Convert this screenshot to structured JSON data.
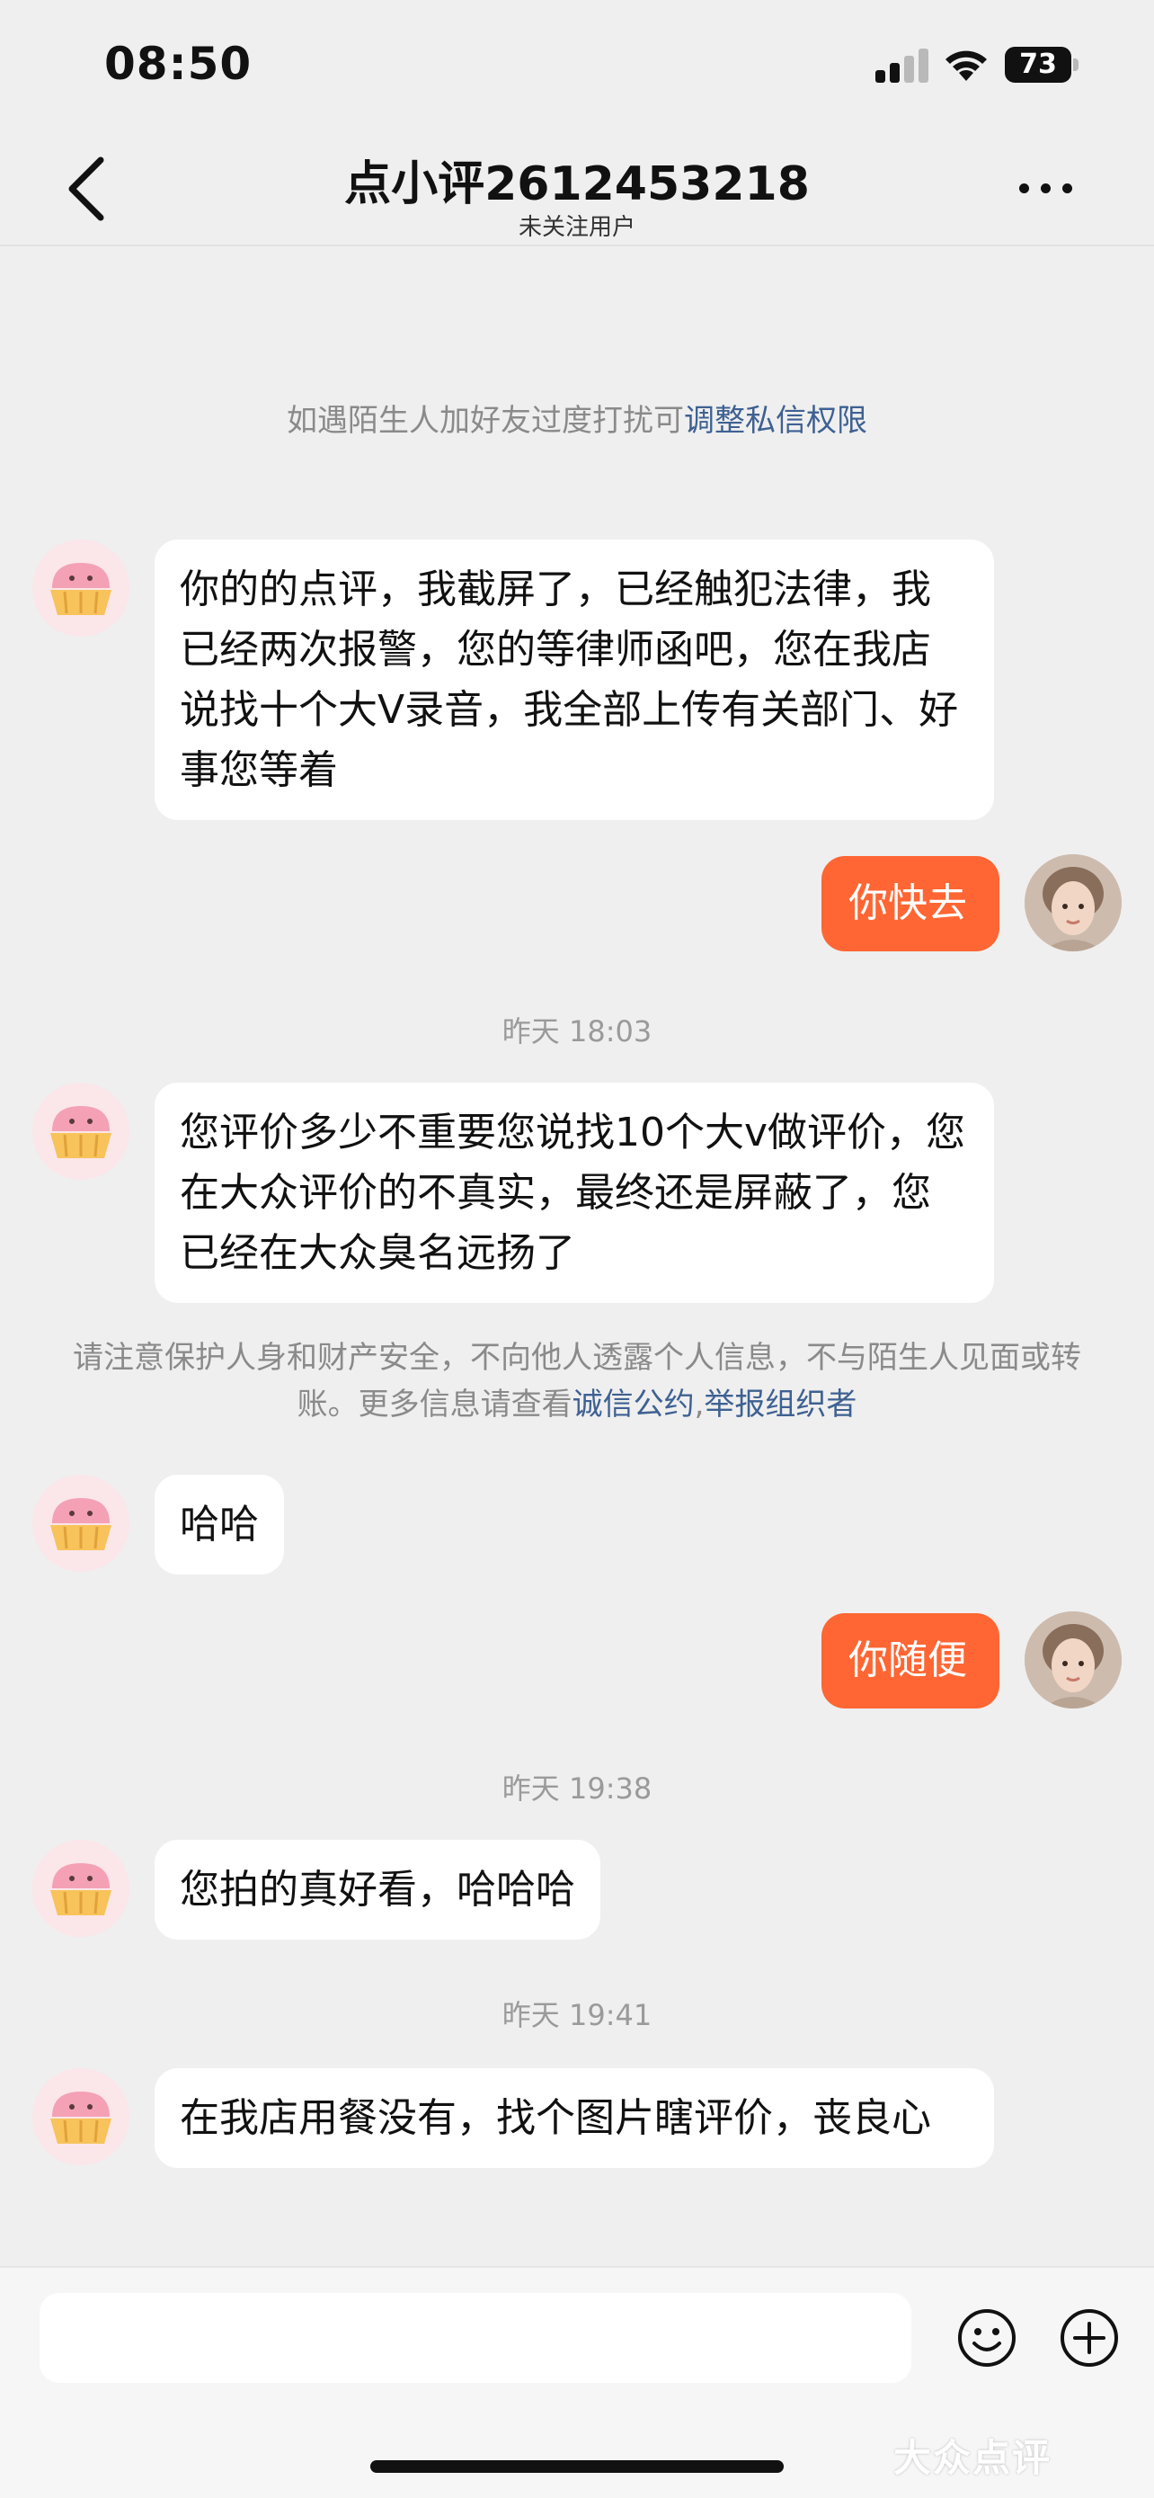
{
  "status_bar": {
    "time": "08:50",
    "battery": "73"
  },
  "nav": {
    "title": "点小评2612453218",
    "subtitle": "未关注用户"
  },
  "notices": {
    "privacy_text": "如遇陌生人加好友过度打扰可",
    "privacy_link": "调整私信权限",
    "safety_text_1": "请注意保护人身和财产安全，不向他人透露个人信息，不与陌生人见面或转账。更多信息请查看",
    "safety_link_1": "诚信公约",
    "safety_sep": ",",
    "safety_link_2": "举报组织者"
  },
  "messages": [
    {
      "from": "other",
      "text": "你的的点评，我截屏了，已经触犯法律，我已经两次报警，您的等律师函吧，您在我店说找十个大V录音，我全部上传有关部门、好事您等着"
    },
    {
      "from": "me",
      "text": "你快去"
    },
    {
      "from": "timestamp",
      "text": "昨天 18:03"
    },
    {
      "from": "other",
      "text": "您评价多少不重要您说找10个大v做评价，您在大众评价的不真实，最终还是屏蔽了，您已经在大众臭名远扬了"
    },
    {
      "from": "other",
      "text": "哈哈"
    },
    {
      "from": "me",
      "text": "你随便"
    },
    {
      "from": "timestamp",
      "text": "昨天 19:38"
    },
    {
      "from": "other",
      "text": "您拍的真好看，哈哈哈"
    },
    {
      "from": "timestamp",
      "text": "昨天 19:41"
    },
    {
      "from": "other",
      "text": "在我店用餐没有，找个图片瞎评价，丧良心"
    }
  ],
  "composer": {
    "value": "",
    "placeholder": ""
  },
  "watermark": "大众点评",
  "colors": {
    "accent": "#ff6633",
    "link": "#3e6192",
    "background": "#efefef"
  },
  "icons": {
    "back": "chevron-left-icon",
    "more": "more-dots-icon",
    "emoji": "smile-icon",
    "plus": "plus-circle-icon",
    "wifi": "wifi-icon",
    "signal": "signal-icon",
    "battery": "battery-icon"
  }
}
